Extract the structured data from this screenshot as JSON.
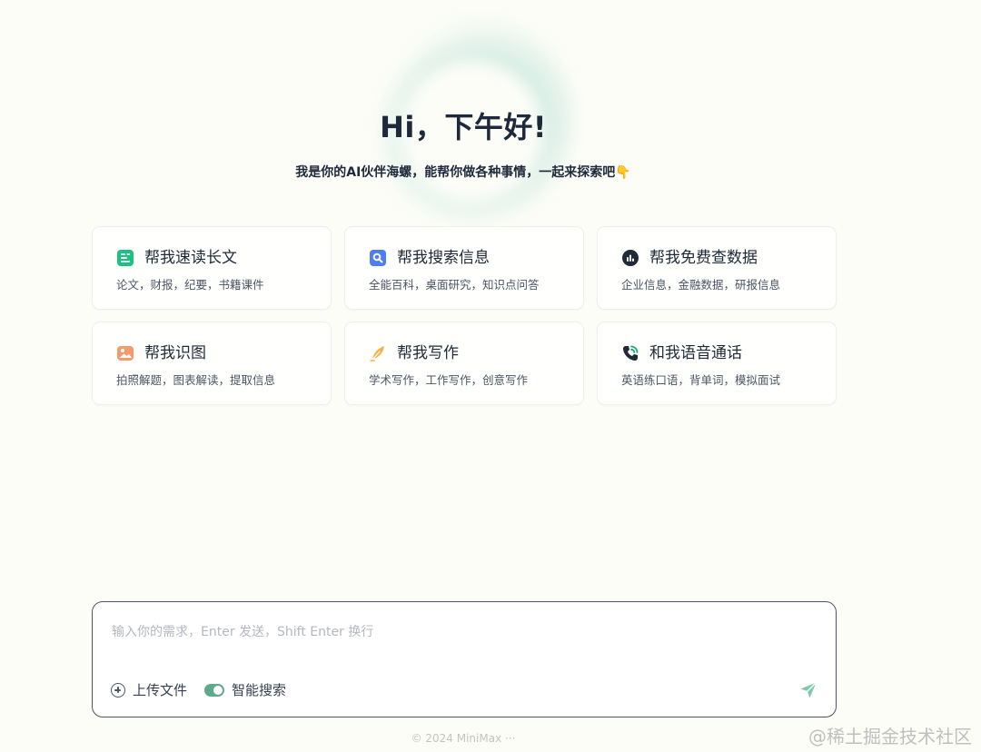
{
  "hero": {
    "title": "Hi，下午好!",
    "subtitle": "我是你的AI伙伴海螺，能帮你做各种事情，一起来探索吧👇"
  },
  "cards": [
    {
      "title": "帮我速读长文",
      "description": "论文，财报，纪要，书籍课件",
      "icon": "document-reading-icon"
    },
    {
      "title": "帮我搜索信息",
      "description": "全能百科，桌面研究，知识点问答",
      "icon": "search-document-icon"
    },
    {
      "title": "帮我免费查数据",
      "description": "企业信息，金融数据，研报信息",
      "icon": "data-chart-search-icon"
    },
    {
      "title": "帮我识图",
      "description": "拍照解题，图表解读，提取信息",
      "icon": "image-icon"
    },
    {
      "title": "帮我写作",
      "description": "学术写作，工作写作，创意写作",
      "icon": "feather-pen-icon"
    },
    {
      "title": "和我语音通话",
      "description": "英语练口语，背单词，模拟面试",
      "icon": "phone-call-icon"
    }
  ],
  "composer": {
    "placeholder": "输入你的需求，Enter 发送，Shift Enter 换行",
    "upload_label": "上传文件",
    "search_label": "智能搜索",
    "search_enabled": true
  },
  "footer": {
    "text": "© 2024 MiniMax ···"
  },
  "watermark": {
    "text": "@稀土掘金技术社区"
  },
  "colors": {
    "background": "#fdfdf8",
    "accent": "#5fa98e",
    "title": "#1e293b"
  }
}
